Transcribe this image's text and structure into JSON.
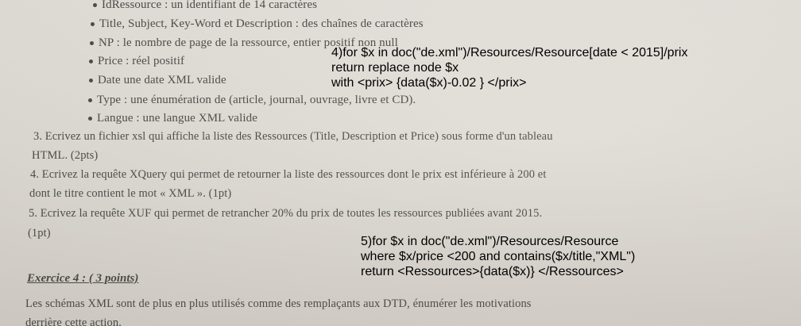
{
  "bullets": [
    "IdRessource : un identifiant de 14 caractères",
    "Title, Subject, Key-Word et Description : des chaînes de caractères",
    "NP : le nombre de page de la ressource, entier positif non null",
    "Price : réel positif",
    "Date une date XML valide",
    "Type : une énumération de (article, journal, ouvrage, livre et CD).",
    "Langue : une langue XML valide"
  ],
  "questions": [
    "3. Ecrivez un fichier xsl qui affiche la liste des Ressources (Title, Description et Price) sous forme d'un tableau",
    "HTML. (2pts)",
    "4. Ecrivez la requête XQuery qui permet de retourner la liste des ressources dont le prix est inférieure à 200 et",
    "dont le titre contient le mot « XML ». (1pt)",
    "5. Ecrivez la requête XUF qui permet de retrancher 20% du prix de toutes les ressources publiées avant 2015.",
    "(1pt)"
  ],
  "exercise": {
    "title": "Exercice 4 : ( 3 points)",
    "text": [
      "Les schémas XML sont de plus en plus utilisés comme des remplaçants aux DTD, énumérer les motivations",
      "derrière cette action."
    ]
  },
  "answer4": [
    "4)for $x in doc(\"de.xml\")/Resources/Resource[date < 2015]/prix",
    "return replace node $x",
    "with <prix> {data($x)-0.02 } </prix>"
  ],
  "answer5": [
    "5)for $x in doc(\"de.xml\")/Resources/Resource",
    "where $x/price <200 and contains($x/title,\"XML\")",
    "return <Ressources>{data($x)} </Ressources>"
  ]
}
